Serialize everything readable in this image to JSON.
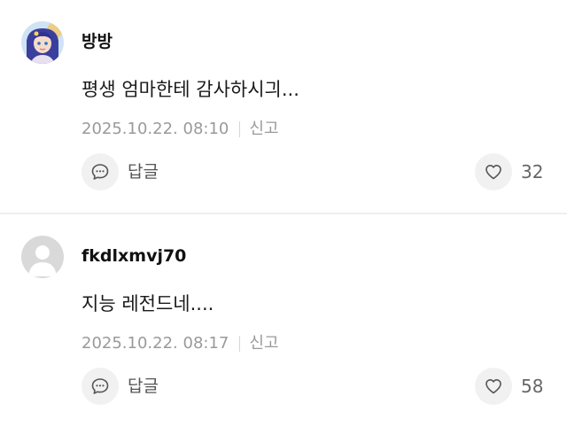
{
  "comments": [
    {
      "username": "방방",
      "avatar": "anime-character-avatar",
      "text": "평생 엄마한테 감사하시긔...",
      "timestamp": "2025.10.22. 08:10",
      "report_label": "신고",
      "reply_label": "답글",
      "like_count": "32"
    },
    {
      "username": "fkdlxmvj70",
      "avatar": "default-user-avatar",
      "text": "지능 레전드네....",
      "timestamp": "2025.10.22. 08:17",
      "report_label": "신고",
      "reply_label": "답글",
      "like_count": "58"
    }
  ],
  "colors": {
    "icon_bg": "#f1f1f1",
    "meta_text": "#9a9a9a",
    "divider": "#eeeeee"
  },
  "icons": {
    "reply": "speech-bubble-icon",
    "like": "heart-outline-icon"
  }
}
